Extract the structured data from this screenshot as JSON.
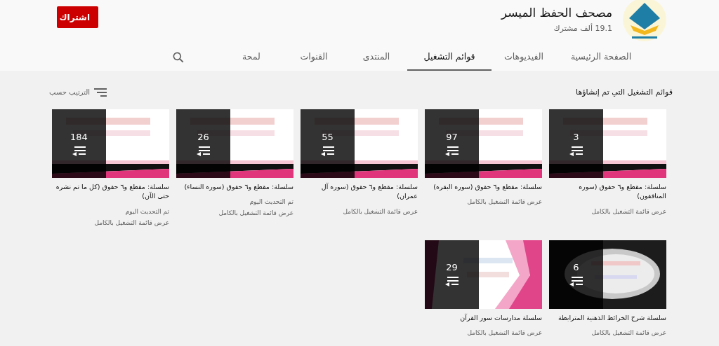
{
  "channel": {
    "name": "مصحف الحفظ الميسر",
    "subscribers": "19.1 ألف مشترك",
    "subscribe_label": "اشتراك"
  },
  "tabs": [
    {
      "label": "الصفحة الرئيسية",
      "selected": false
    },
    {
      "label": "الفيديوهات",
      "selected": false
    },
    {
      "label": "قوائم التشغيل",
      "selected": true
    },
    {
      "label": "المنتدى",
      "selected": false
    },
    {
      "label": "القنوات",
      "selected": false
    },
    {
      "label": "لمحة",
      "selected": false
    }
  ],
  "section": {
    "title": "قوائم التشغيل التي تم إنشاؤها",
    "sort_label": "الترتيب حسب"
  },
  "playlists": [
    {
      "count": "3",
      "title": "سلسلة: مقطع و٦ حقوق (سوره المنافقون)",
      "link": "عرض قائمة التشغيل بالكامل"
    },
    {
      "count": "97",
      "title": "سلسلة: مقطع و٦ حقوق (سوره البقره)",
      "link": "عرض قائمة التشغيل بالكامل"
    },
    {
      "count": "55",
      "title": "سلسلة: مقطع و٦ حقوق (سوره آل عمران)",
      "link": "عرض قائمة التشغيل بالكامل"
    },
    {
      "count": "26",
      "title": "سلسلة: مقطع و٦ حقوق (سوره النساء)",
      "updated": "تم التحديث اليوم",
      "link": "عرض قائمة التشغيل بالكامل"
    },
    {
      "count": "184",
      "title": "سلسلة: مقطع و٦ حقوق (كل ما تم نشره حتى الآن)",
      "updated": "تم التحديث اليوم",
      "link": "عرض قائمة التشغيل بالكامل"
    },
    {
      "count": "6",
      "title": "سلسلة شرح الخرائط الذهنية المترابطة",
      "link": "عرض قائمة التشغيل بالكامل"
    },
    {
      "count": "29",
      "title": "سلسلة مدارسات سور القرآن",
      "link": "عرض قائمة التشغيل بالكامل"
    }
  ]
}
